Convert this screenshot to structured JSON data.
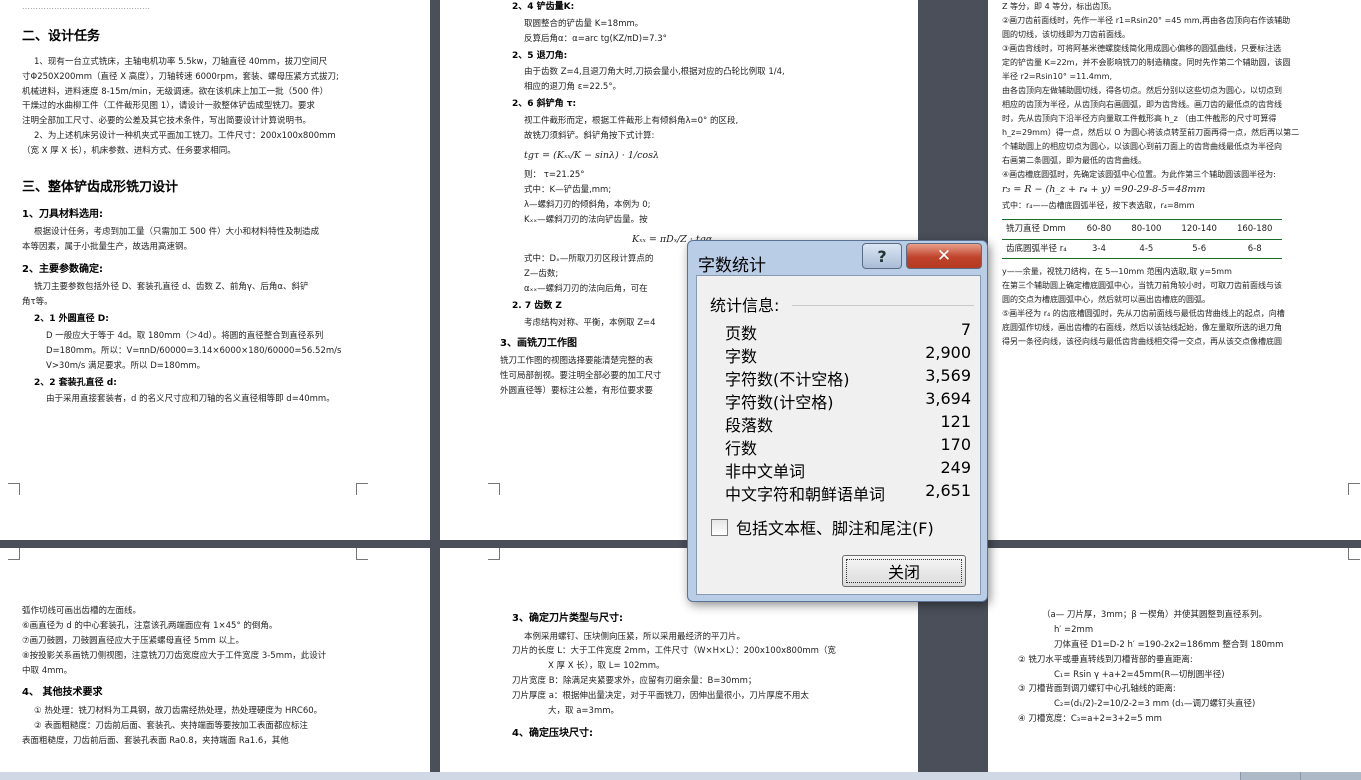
{
  "dialog": {
    "title": "字数统计",
    "help_label": "?",
    "close_label": "✕",
    "stats_label": "统计信息:",
    "stats": [
      {
        "label": "页数",
        "value": "7"
      },
      {
        "label": "字数",
        "value": "2,900"
      },
      {
        "label": "字符数(不计空格)",
        "value": "3,569"
      },
      {
        "label": "字符数(计空格)",
        "value": "3,694"
      },
      {
        "label": "段落数",
        "value": "121"
      },
      {
        "label": "行数",
        "value": "170"
      },
      {
        "label": "非中文单词",
        "value": "249"
      },
      {
        "label": "中文字符和朝鲜语单词",
        "value": "2,651"
      }
    ],
    "include_label": "包括文本框、脚注和尾注(F)",
    "include_checked": false,
    "ok_label": "关闭"
  },
  "page1": {
    "top": "…………………………………………",
    "h_task": "二、设计任务",
    "task_lines": [
      "1、现有一台立式铣床，主轴电机功率 5.5kw，刀轴直径 40mm，拔刀空间尺",
      "寸Φ250X200mm（直径 X 高度），刀轴转速 6000rpm，套装、螺母压紧方式拔刀;",
      "机械进料，进料速度 8-15m/min，无级调速。欲在该机床上加工一批（500 件）",
      "干燥过的水曲柳工件（工件截形见图 1），请设计一款整体铲齿成型铣刀。要求",
      "注明全部加工尺寸、必要的公差及其它技术条件，写出简要设计计算说明书。",
      "2、为上述机床另设计一种机夹式平面加工铣刀。工件尺寸：200x100x800mm",
      "（宽 X 厚 X 长），机床参数、进料方式、任务要求相同。"
    ],
    "h_design": "三、整体铲齿成形铣刀设计",
    "h_material": "1、刀具材料选用:",
    "material_lines": [
      "根据设计任务，考虑到加工量（只需加工 500 件）大小和材料特性及制造成",
      "本等因素，属于小批量生产，故选用高速钢。"
    ],
    "h_params": "2、主要参数确定:",
    "params_lines": [
      "铣刀主要参数包括外径 D、套装孔直径 d、齿数 Z、前角γ、后角α、斜铲",
      "角τ等。"
    ],
    "h_outer": "2、1 外圆直径 D:",
    "outer_lines": [
      "D 一般应大于等于 4d。取 180mm（＞4d）。将圆的直径整合到直径系列",
      "D=180mm。所以：V=πnD/60000=3.14×6000×180/60000=56.52m/s",
      "V>30m/s 满足要求。所以 D=180mm。"
    ],
    "h_hole": "2、2 套装孔直径 d:",
    "hole_lines": [
      "由于采用直接套装者，d 的名义尺寸应和刀轴的名义直径相等即 d=40mm。"
    ]
  },
  "page2": {
    "h_spade": "2、4 铲齿量K:",
    "spade_lines": [
      "取圆整合的铲齿量 K=18mm。",
      "反算后角α：α=arc tg(KZ/πD)=7.3°"
    ],
    "h_retreat": "2、5 退刀角:",
    "retreat_lines": [
      "由于齿数 Z=4,且退刀角大时,刀损会量小,根据对应的凸轮比例取 1/4,",
      "相应的退刀角 ε=22.5°。"
    ],
    "h_oblique": "2、6 斜铲角 τ:",
    "oblique_lines": [
      "视工件截形而定，根据工件截形上有倾斜角λ=0° 的区段,",
      "故铣刀须斜铲。斜铲角按下式计算:"
    ],
    "formula": "tgτ = (Kₓₓ/K − sinλ) · 1/cosλ",
    "oblique_result": "则：  τ=21.25°",
    "oblique_notes": [
      "式中：K—铲齿量,mm;",
      "λ—螺斜刀刃的倾斜角，本例为 0;",
      "Kₓₓ—螺斜刀刃的法向铲齿量。按"
    ],
    "formula2": "Kₓₓ = πDₓ/Z · tgα",
    "formula2_notes": [
      "式中：Dₓ—所取刀刃区段计算点的",
      "Z—齿数;",
      "αₓₓ—螺斜刀刃的法向后角，可在"
    ],
    "h_teeth": "2. 7 齿数 Z",
    "teeth_line": "考虑结构对称、平衡，本例取 Z=4",
    "h_draw": "3、画铣刀工作图",
    "draw_lines": [
      "铣刀工作图的视图选择要能清楚完整的表",
      "性可局部剖视。要注明全部必要的加工尺寸",
      "外圆直径等）要标注公差，有形位要求要"
    ]
  },
  "page3": {
    "lines": [
      "Z 等分，即 4 等分，标出齿顶。",
      "②画刀齿前面线时，先作一半径 r1=Rsin20° =45 mm,再由各齿顶向右作该辅助",
      "圆的切线，该切线即为刀齿前面线。",
      "③画齿背线时，可将阿基米德螺旋线简化用成圆心偏移的圆弧曲线，只要标注选",
      "定的铲齿量 K=22m，并不会影响铣刀的制造精度。同时先作第二个辅助圆，该圆",
      "半径 r2=Rsin10° =11.4mm,",
      "由各齿顶向左做辅助圆切线，得各切点。然后分别以这些切点为圆心，以切点到",
      "相应的齿顶为半径，从齿顶向右画圆弧，即为齿背线。画刀齿的最低点的齿背线",
      "时，先从齿顶向下沿半径方向量取工件截形高 h_z （由工件截形的尺寸可算得",
      "h_z=29mm）得一点，然后以 O 为圆心将该点转至前刀面再得一点，然后再以第二",
      "个辅助圆上的相应切点为圆心，以该圆心到前刀面上的齿背曲线最低点为半径向",
      "右画第二条圆弧，即为最低的齿背曲线。",
      "④画齿槽底圆弧时，先确定该圆弧中心位置。为此作第三个辅助圆该圆半径为:",
      "r₃ = R − (h_z + r₄ + y) =90-29-8-5=48mm",
      "式中：r₄——齿槽底圆弧半径，按下表选取，r₄=8mm"
    ],
    "table": {
      "headers": [
        "铣刀直径 Dmm",
        "60-80",
        "80-100",
        "120-140",
        "160-180"
      ],
      "row": [
        "齿底圆弧半径 r₄",
        "3-4",
        "4-5",
        "5-6",
        "6-8"
      ]
    },
    "lines2": [
      "y——余量，视铣刀结构，在 5—10mm 范围内选取,取 y=5mm",
      "在第三个辅助圆上确定槽底圆弧中心，当铣刀前角较小时，可取刀齿前面线与该",
      "圆的交点为槽底圆弧中心，然后就可以画出齿槽底的圆弧。",
      "⑤画半径为 r₄ 的齿底槽圆弧时，先从刀齿前面线与最低齿背曲线上的起点，向槽",
      "底圆弧作切线，画出齿槽的右面线，然后以该钻线起始，像左量取所选的退刀角",
      "得另一条径向线，该径向线与最低齿背曲线相交得一交点，再从该交点像槽底圆"
    ]
  },
  "page4": {
    "lines": [
      "弧作切线可画出齿槽的左面线。",
      "⑥画直径为 d 的中心套装孔，注意该孔两端面应有 1×45° 的倒角。",
      "⑦画刀鼓圆，刀鼓圆直径应大于压紧螺母直径 5mm 以上。",
      "⑧按投影关系画铣刀侧视图，注意铣刀刀齿宽度应大于工件宽度 3-5mm，此设计",
      "中取 4mm。"
    ],
    "h_other": "4、  其他技术要求",
    "other_lines": [
      "① 热处理：铣刀材料为工具钢，故刀齿需经热处理，热处理硬度为 HRC60。",
      "② 表面粗糙度：刀齿前后面、套装孔、夹持端面等要按加工表面都应标注",
      "表面粗糙度，刀齿前后面、套装孔表面 Ra0.8，夹持端面 Ra1.6，其他"
    ]
  },
  "page5": {
    "h_blade": "3、确定刀片类型与尺寸:",
    "blade_intro": "本例采用螺钉、压块侧向压紧，所以采用最经济的平刀片。",
    "blade_lines": [
      "刀片的长度 L：大于工件宽度 2mm，工件尺寸（W×H×L）：200x100x800mm（宽",
      "X 厚 X 长），取 L= 102mm。",
      "刀片宽度 B：除满足夹紧要求外，应留有刃磨余量：B=30mm；",
      "刀片厚度 a：根据伸出量决定，对于平面铣刀，因伸出量很小，刀片厚度不用太",
      "大，取 a=3mm。"
    ],
    "h_block": "4、确定压块尺寸:"
  },
  "page6": {
    "lines": [
      "（a—  刀片厚，3mm；β 一楔角）并使其圆整到直径系列。",
      "h′ =2mm",
      "刀体直径 D1=D-2 h′ =190-2x2=186mm  整合到 180mm",
      "②  铣刀水平或垂直转线到刀槽背部的垂直距离:",
      "C₁= Rsin γ +a+2=45mm(R—切削圆半径)",
      "③  刀槽背面到调刀螺钉中心孔轴线的距离:",
      "C₂=(d₁/2)-2=10/2-2=3 mm        (d₁—调刀螺钉头直径)",
      "④  刀槽宽度：C₃=a+2=3+2=5 mm"
    ]
  }
}
